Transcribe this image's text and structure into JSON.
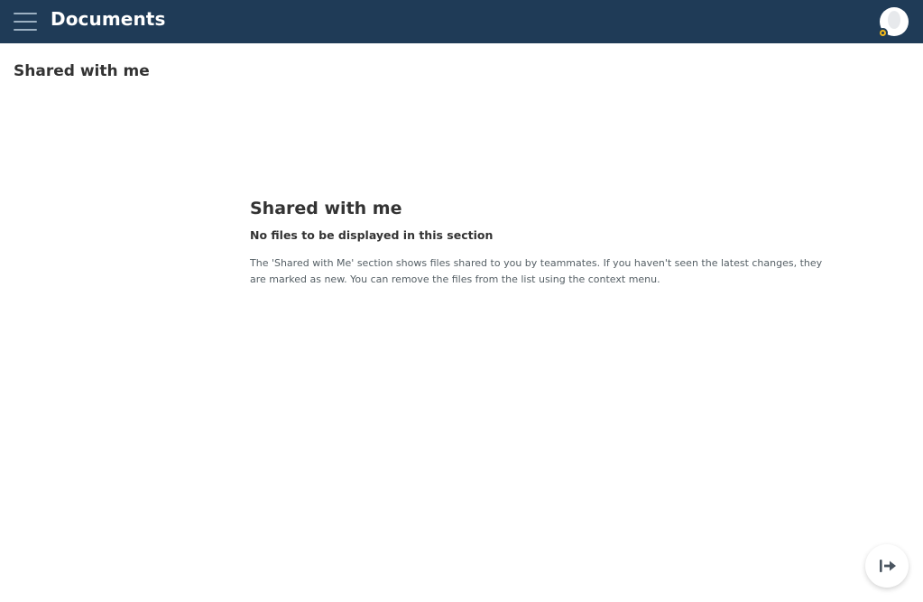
{
  "header": {
    "menu_icon": "hamburger-menu-icon",
    "title": "Documents",
    "avatar_icon": "user-avatar-icon",
    "badge_color": "#f2b91b",
    "bar_color": "#1f3b57"
  },
  "page": {
    "heading": "Shared with me"
  },
  "empty_state": {
    "title": "Shared with me",
    "subtitle": "No files to be displayed in this section",
    "description": "The 'Shared with Me' section shows files shared to you by teammates. If you haven't seen the latest changes, they are marked as new. You can remove the files from the list using the context menu."
  },
  "fab": {
    "icon": "collapse-to-right-icon"
  }
}
